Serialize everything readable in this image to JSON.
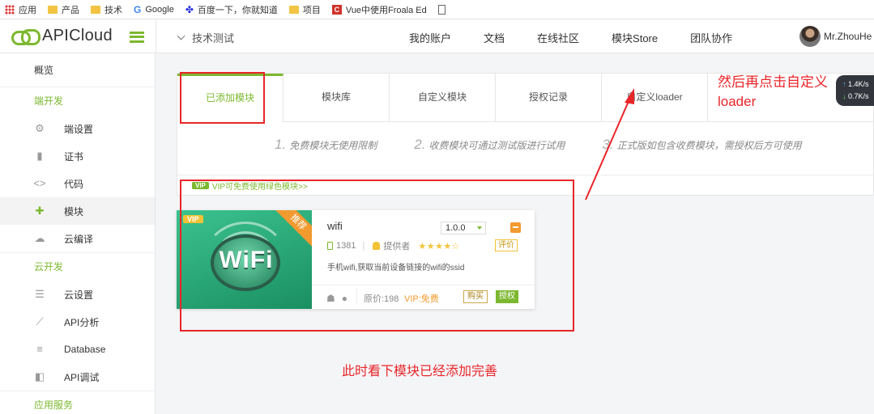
{
  "bookmarks": {
    "apps": "应用",
    "product": "产品",
    "tech": "技术",
    "google": "Google",
    "baidu": "百度一下，你就知道",
    "project": "项目",
    "vue_froala": "Vue中使用Froala Ed"
  },
  "header": {
    "logo": "APICloud",
    "project": "技术测试",
    "nav": [
      "我的账户",
      "文档",
      "在线社区",
      "模块Store",
      "团队协作"
    ],
    "user": "Mr.ZhouHe"
  },
  "sidebar": {
    "overview": "概览",
    "group_client": "端开发",
    "client_items": [
      {
        "label": "端设置",
        "icon": "gear-icon"
      },
      {
        "label": "证书",
        "icon": "certificate-icon"
      },
      {
        "label": "代码",
        "icon": "code-icon"
      },
      {
        "label": "模块",
        "icon": "puzzle-icon"
      },
      {
        "label": "云编译",
        "icon": "cloud-icon"
      }
    ],
    "group_cloud": "云开发",
    "cloud_items": [
      {
        "label": "云设置",
        "icon": "sliders-icon"
      },
      {
        "label": "API分析",
        "icon": "chart-icon"
      },
      {
        "label": "Database",
        "icon": "database-icon"
      },
      {
        "label": "API调试",
        "icon": "debug-icon"
      }
    ],
    "group_app": "应用服务"
  },
  "tabs": [
    "已添加模块",
    "模块库",
    "自定义模块",
    "授权记录",
    "自定义loader"
  ],
  "tips": [
    {
      "num": "1.",
      "text": "免费模块无使用限制"
    },
    {
      "num": "2.",
      "text": "收费模块可通过测试版进行试用"
    },
    {
      "num": "3.",
      "text": "正式版如包含收费模块，需授权后方可使用"
    }
  ],
  "vip_bar": {
    "badge": "VIP",
    "text": "VIP可免费使用绿色模块>>"
  },
  "module": {
    "image_text": "WiFi",
    "vip_badge": "VIP",
    "ribbon": "推荐",
    "title": "wifi",
    "version": "1.0.0",
    "downloads": "1381",
    "provider": "提供者",
    "rating_stars": "★★★★☆",
    "rate_button": "评价",
    "description": "手机wifi,获取当前设备链接的wifi的ssid",
    "price": "原价:198",
    "vip_free": "VIP:免费",
    "buy_button": "购买",
    "auth_button": "授权"
  },
  "annotations": {
    "top_note": "然后再点击自定义\nloader",
    "bottom_note": "此时看下模块已经添加完善",
    "color": "#e8262a"
  },
  "speed": {
    "up": "1.4K/s",
    "down": "0.7K/s"
  },
  "colors": {
    "brand": "#7cb82f",
    "orange": "#f19a2f",
    "annotation": "#e8262a"
  }
}
